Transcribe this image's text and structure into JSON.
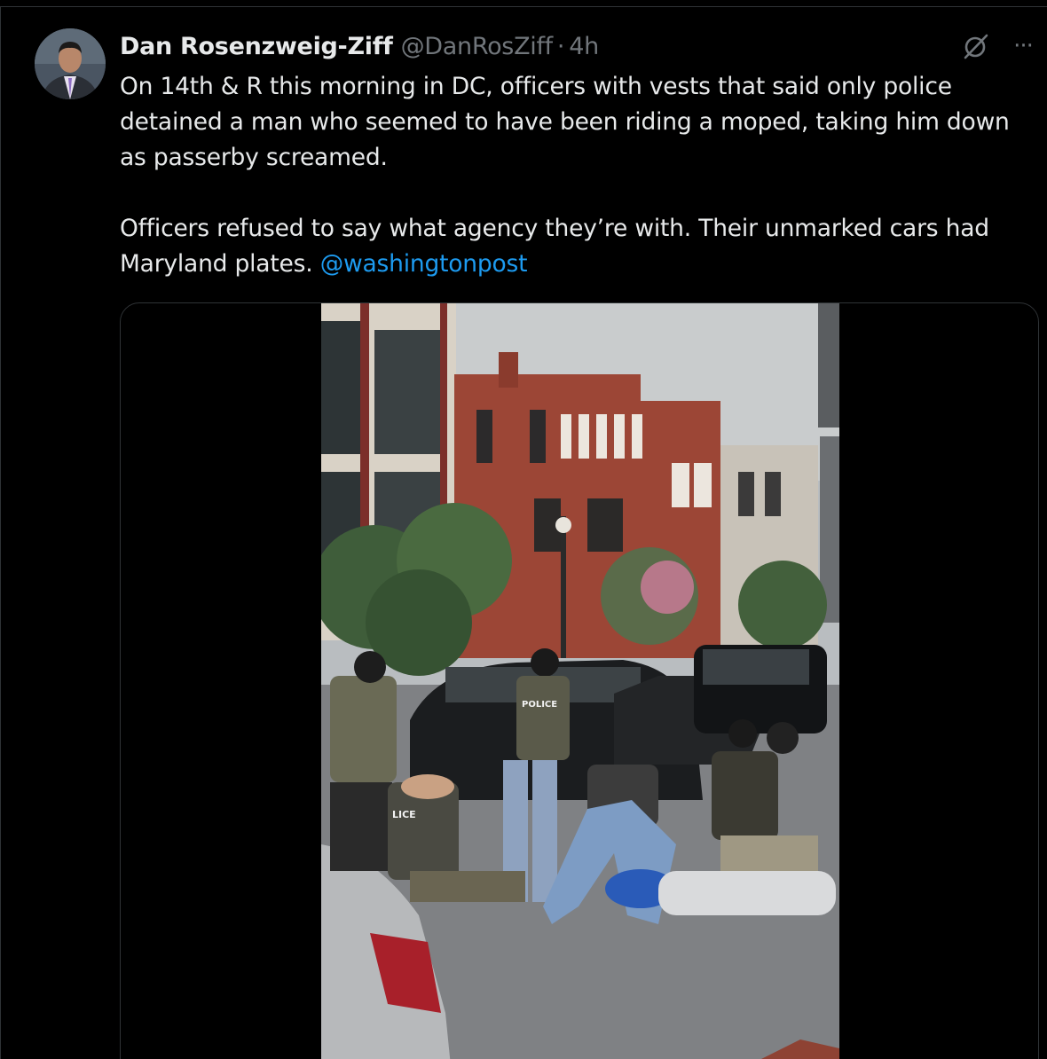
{
  "tweet": {
    "author": {
      "display_name": "Dan Rosenzweig-Ziff",
      "handle": "@DanRosZiff",
      "separator": "·",
      "time": "4h",
      "avatar_icon": "profile-photo"
    },
    "text": {
      "paragraph_1": "On 14th & R this morning in DC, officers with vests that said only police detained a man who seemed to have been riding a moped, taking him down as passerby screamed.",
      "paragraph_2_text": "Officers refused to say what agency they’re with. Their unmarked cars had Maryland plates. ",
      "paragraph_2_mention": "@washingtonpost"
    },
    "actions": {
      "grok_icon": "grok-icon",
      "more_icon": "more-icon",
      "more_label": "···"
    },
    "media": {
      "type": "video",
      "vest_label_1": "POLICE",
      "vest_label_2": "LICE"
    }
  },
  "colors": {
    "background": "#000000",
    "text": "#e7e9ea",
    "secondary": "#71767b",
    "link": "#1d9bf0",
    "border": "#2f3336"
  }
}
